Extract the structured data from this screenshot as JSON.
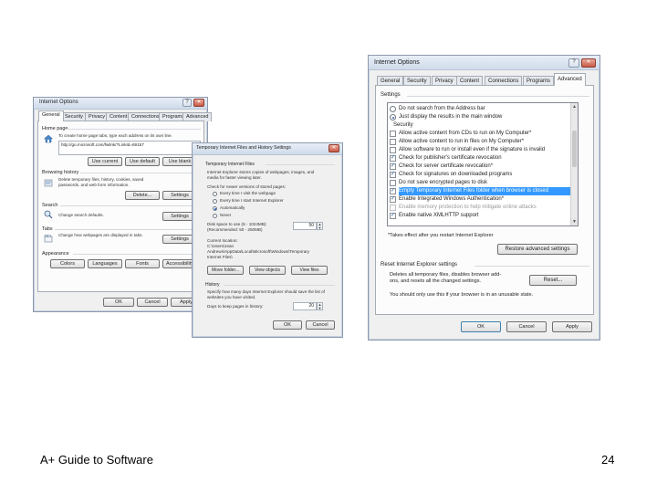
{
  "left_window": {
    "title": "Internet Options",
    "tabs": [
      "General",
      "Security",
      "Privacy",
      "Content",
      "Connections",
      "Programs",
      "Advanced"
    ],
    "home_page": {
      "heading": "Home page",
      "description": "To create home page tabs, type each address on its own line.",
      "url": "http://go.microsoft.com/fwlink/?LinkId=69157",
      "buttons": [
        "Use current",
        "Use default",
        "Use blank"
      ]
    },
    "browsing_history": {
      "heading": "Browsing history",
      "description": "Delete temporary files, history, cookies, saved passwords, and web form information.",
      "buttons": [
        "Delete...",
        "Settings"
      ]
    },
    "search": {
      "heading": "Search",
      "description": "Change search defaults.",
      "button": "Settings"
    },
    "tabs_section": {
      "heading": "Tabs",
      "description": "Change how webpages are displayed in tabs.",
      "button": "Settings"
    },
    "appearance": {
      "heading": "Appearance",
      "buttons": [
        "Colors",
        "Languages",
        "Fonts",
        "Accessibility"
      ]
    },
    "footer_buttons": [
      "OK",
      "Cancel",
      "Apply"
    ]
  },
  "middle_window": {
    "title": "Temporary Internet Files and History Settings",
    "temp_files": {
      "heading": "Temporary Internet Files",
      "description": "Internet Explorer stores copies of webpages, images, and media for faster viewing later.",
      "check_label": "Check for newer versions of stored pages:",
      "options": [
        {
          "label": "Every time I visit the webpage",
          "selected": false
        },
        {
          "label": "Every time I start Internet Explorer",
          "selected": false
        },
        {
          "label": "Automatically",
          "selected": true
        },
        {
          "label": "Never",
          "selected": false
        }
      ],
      "disk_label": "Disk space to use (8 - 1024MB):",
      "disk_recommended": "(Recommended: 50 - 250MB)",
      "disk_value": "50"
    },
    "current_location": {
      "label": "Current location:",
      "path": "C:\\Users\\Jean Andrews\\AppData\\Local\\Microsoft\\Windows\\Temporary Internet Files\\"
    },
    "location_buttons": [
      "Move folder...",
      "View objects",
      "View files"
    ],
    "history": {
      "heading": "History",
      "description": "Specify how many days Internet Explorer should save the list of websites you have visited.",
      "days_label": "Days to keep pages in history:",
      "days_value": "20"
    },
    "footer_buttons": [
      "OK",
      "Cancel"
    ]
  },
  "right_window": {
    "title": "Internet Options",
    "tabs": [
      "General",
      "Security",
      "Privacy",
      "Content",
      "Connections",
      "Programs",
      "Advanced"
    ],
    "active_tab": "Advanced",
    "settings_label": "Settings",
    "settings": [
      {
        "label": "Do not search from the Address bar",
        "kind": "radio",
        "checked": false,
        "selected": false,
        "disabled": false
      },
      {
        "label": "Just display the results in the main window",
        "kind": "radio",
        "checked": true,
        "selected": false,
        "disabled": false
      },
      {
        "label": "Security",
        "kind": "category",
        "checked": false,
        "selected": false,
        "disabled": false
      },
      {
        "label": "Allow active content from CDs to run on My Computer*",
        "kind": "check",
        "checked": false,
        "selected": false,
        "disabled": false
      },
      {
        "label": "Allow active content to run in files on My Computer*",
        "kind": "check",
        "checked": false,
        "selected": false,
        "disabled": false
      },
      {
        "label": "Allow software to run or install even if the signature is invalid",
        "kind": "check",
        "checked": false,
        "selected": false,
        "disabled": false
      },
      {
        "label": "Check for publisher's certificate revocation",
        "kind": "check",
        "checked": true,
        "selected": false,
        "disabled": false
      },
      {
        "label": "Check for server certificate revocation*",
        "kind": "check",
        "checked": true,
        "selected": false,
        "disabled": false
      },
      {
        "label": "Check for signatures on downloaded programs",
        "kind": "check",
        "checked": true,
        "selected": false,
        "disabled": false
      },
      {
        "label": "Do not save encrypted pages to disk",
        "kind": "check",
        "checked": false,
        "selected": false,
        "disabled": false
      },
      {
        "label": "Empty Temporary Internet Files folder when browser is closed",
        "kind": "check",
        "checked": true,
        "selected": true,
        "disabled": false
      },
      {
        "label": "Enable Integrated Windows Authentication*",
        "kind": "check",
        "checked": true,
        "selected": false,
        "disabled": false
      },
      {
        "label": "Enable memory protection to help mitigate online attacks",
        "kind": "check",
        "checked": false,
        "selected": false,
        "disabled": true
      },
      {
        "label": "Enable native XMLHTTP support",
        "kind": "check",
        "checked": true,
        "selected": false,
        "disabled": false
      }
    ],
    "restart_note": "*Takes effect after you restart Internet Explorer",
    "restore_button": "Restore advanced settings",
    "reset": {
      "heading": "Reset Internet Explorer settings",
      "description": "Deletes all temporary files, disables browser add-ons, and resets all the changed settings.",
      "button": "Reset...",
      "warning": "You should only use this if your browser is in an unusable state."
    },
    "footer_buttons": [
      "OK",
      "Cancel",
      "Apply"
    ]
  },
  "slide_footer": {
    "left": "A+ Guide to Software",
    "right": "24"
  }
}
